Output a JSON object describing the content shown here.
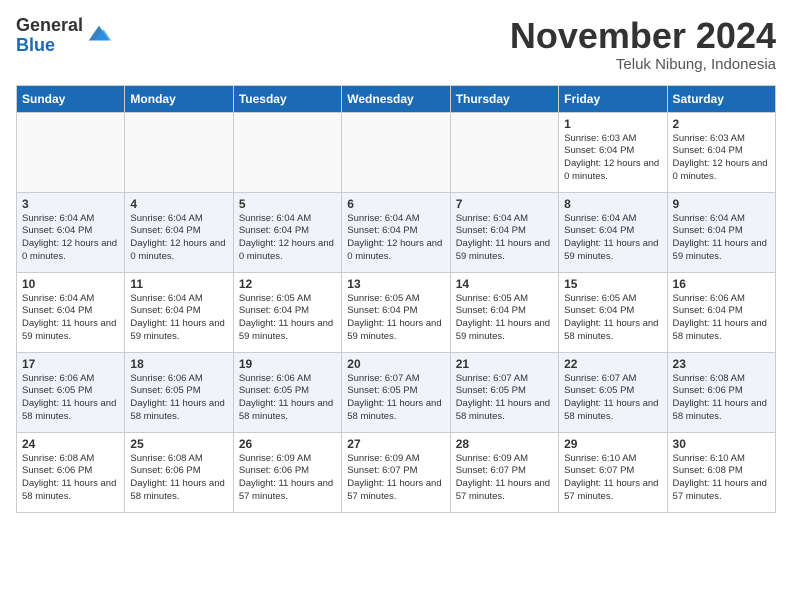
{
  "header": {
    "logo_line1": "General",
    "logo_line2": "Blue",
    "month": "November 2024",
    "location": "Teluk Nibung, Indonesia"
  },
  "weekdays": [
    "Sunday",
    "Monday",
    "Tuesday",
    "Wednesday",
    "Thursday",
    "Friday",
    "Saturday"
  ],
  "weeks": [
    [
      {
        "day": "",
        "info": ""
      },
      {
        "day": "",
        "info": ""
      },
      {
        "day": "",
        "info": ""
      },
      {
        "day": "",
        "info": ""
      },
      {
        "day": "",
        "info": ""
      },
      {
        "day": "1",
        "info": "Sunrise: 6:03 AM\nSunset: 6:04 PM\nDaylight: 12 hours and 0 minutes."
      },
      {
        "day": "2",
        "info": "Sunrise: 6:03 AM\nSunset: 6:04 PM\nDaylight: 12 hours and 0 minutes."
      }
    ],
    [
      {
        "day": "3",
        "info": "Sunrise: 6:04 AM\nSunset: 6:04 PM\nDaylight: 12 hours and 0 minutes."
      },
      {
        "day": "4",
        "info": "Sunrise: 6:04 AM\nSunset: 6:04 PM\nDaylight: 12 hours and 0 minutes."
      },
      {
        "day": "5",
        "info": "Sunrise: 6:04 AM\nSunset: 6:04 PM\nDaylight: 12 hours and 0 minutes."
      },
      {
        "day": "6",
        "info": "Sunrise: 6:04 AM\nSunset: 6:04 PM\nDaylight: 12 hours and 0 minutes."
      },
      {
        "day": "7",
        "info": "Sunrise: 6:04 AM\nSunset: 6:04 PM\nDaylight: 11 hours and 59 minutes."
      },
      {
        "day": "8",
        "info": "Sunrise: 6:04 AM\nSunset: 6:04 PM\nDaylight: 11 hours and 59 minutes."
      },
      {
        "day": "9",
        "info": "Sunrise: 6:04 AM\nSunset: 6:04 PM\nDaylight: 11 hours and 59 minutes."
      }
    ],
    [
      {
        "day": "10",
        "info": "Sunrise: 6:04 AM\nSunset: 6:04 PM\nDaylight: 11 hours and 59 minutes."
      },
      {
        "day": "11",
        "info": "Sunrise: 6:04 AM\nSunset: 6:04 PM\nDaylight: 11 hours and 59 minutes."
      },
      {
        "day": "12",
        "info": "Sunrise: 6:05 AM\nSunset: 6:04 PM\nDaylight: 11 hours and 59 minutes."
      },
      {
        "day": "13",
        "info": "Sunrise: 6:05 AM\nSunset: 6:04 PM\nDaylight: 11 hours and 59 minutes."
      },
      {
        "day": "14",
        "info": "Sunrise: 6:05 AM\nSunset: 6:04 PM\nDaylight: 11 hours and 59 minutes."
      },
      {
        "day": "15",
        "info": "Sunrise: 6:05 AM\nSunset: 6:04 PM\nDaylight: 11 hours and 58 minutes."
      },
      {
        "day": "16",
        "info": "Sunrise: 6:06 AM\nSunset: 6:04 PM\nDaylight: 11 hours and 58 minutes."
      }
    ],
    [
      {
        "day": "17",
        "info": "Sunrise: 6:06 AM\nSunset: 6:05 PM\nDaylight: 11 hours and 58 minutes."
      },
      {
        "day": "18",
        "info": "Sunrise: 6:06 AM\nSunset: 6:05 PM\nDaylight: 11 hours and 58 minutes."
      },
      {
        "day": "19",
        "info": "Sunrise: 6:06 AM\nSunset: 6:05 PM\nDaylight: 11 hours and 58 minutes."
      },
      {
        "day": "20",
        "info": "Sunrise: 6:07 AM\nSunset: 6:05 PM\nDaylight: 11 hours and 58 minutes."
      },
      {
        "day": "21",
        "info": "Sunrise: 6:07 AM\nSunset: 6:05 PM\nDaylight: 11 hours and 58 minutes."
      },
      {
        "day": "22",
        "info": "Sunrise: 6:07 AM\nSunset: 6:05 PM\nDaylight: 11 hours and 58 minutes."
      },
      {
        "day": "23",
        "info": "Sunrise: 6:08 AM\nSunset: 6:06 PM\nDaylight: 11 hours and 58 minutes."
      }
    ],
    [
      {
        "day": "24",
        "info": "Sunrise: 6:08 AM\nSunset: 6:06 PM\nDaylight: 11 hours and 58 minutes."
      },
      {
        "day": "25",
        "info": "Sunrise: 6:08 AM\nSunset: 6:06 PM\nDaylight: 11 hours and 58 minutes."
      },
      {
        "day": "26",
        "info": "Sunrise: 6:09 AM\nSunset: 6:06 PM\nDaylight: 11 hours and 57 minutes."
      },
      {
        "day": "27",
        "info": "Sunrise: 6:09 AM\nSunset: 6:07 PM\nDaylight: 11 hours and 57 minutes."
      },
      {
        "day": "28",
        "info": "Sunrise: 6:09 AM\nSunset: 6:07 PM\nDaylight: 11 hours and 57 minutes."
      },
      {
        "day": "29",
        "info": "Sunrise: 6:10 AM\nSunset: 6:07 PM\nDaylight: 11 hours and 57 minutes."
      },
      {
        "day": "30",
        "info": "Sunrise: 6:10 AM\nSunset: 6:08 PM\nDaylight: 11 hours and 57 minutes."
      }
    ]
  ]
}
